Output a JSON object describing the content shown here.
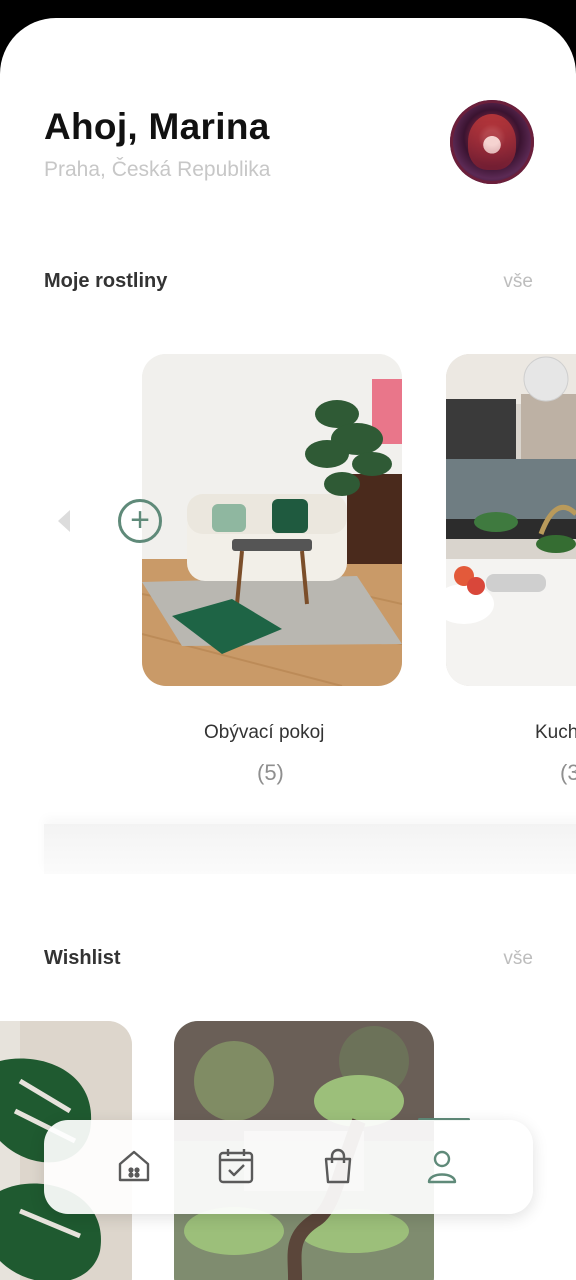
{
  "header": {
    "greeting": "Ahoj, Marina",
    "location": "Praha, Česká Republika"
  },
  "my_plants": {
    "title": "Moje rostliny",
    "see_all": "vše",
    "rooms": [
      {
        "name": "Obývací pokoj",
        "count": "(5)"
      },
      {
        "name": "Kuch",
        "count": "(3"
      }
    ]
  },
  "wishlist": {
    "title": "Wishlist",
    "see_all": "vše"
  },
  "nav": {
    "items": [
      "home-icon",
      "calendar-icon",
      "shopping-bag-icon",
      "profile-icon"
    ],
    "active_index": 3
  },
  "colors": {
    "accent": "#5f8a79",
    "background": "#ffffff"
  }
}
